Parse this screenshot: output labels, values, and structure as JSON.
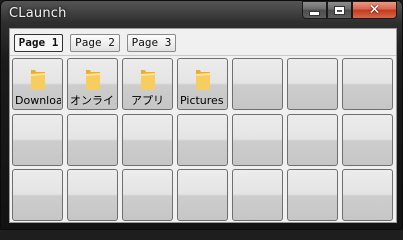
{
  "window": {
    "title": "CLaunch"
  },
  "tabs": [
    {
      "label": "Page 1",
      "active": true
    },
    {
      "label": "Page 2",
      "active": false
    },
    {
      "label": "Page 3",
      "active": false
    }
  ],
  "items": [
    {
      "label": "Downloa",
      "icon": "folder-icon"
    },
    {
      "label": "オンライン",
      "icon": "folder-icon"
    },
    {
      "label": "アプリ",
      "icon": "folder-icon"
    },
    {
      "label": "Pictures",
      "icon": "folder-icon"
    }
  ],
  "colors": {
    "folder": "#f2c24f",
    "close_button": "#c3381d"
  }
}
